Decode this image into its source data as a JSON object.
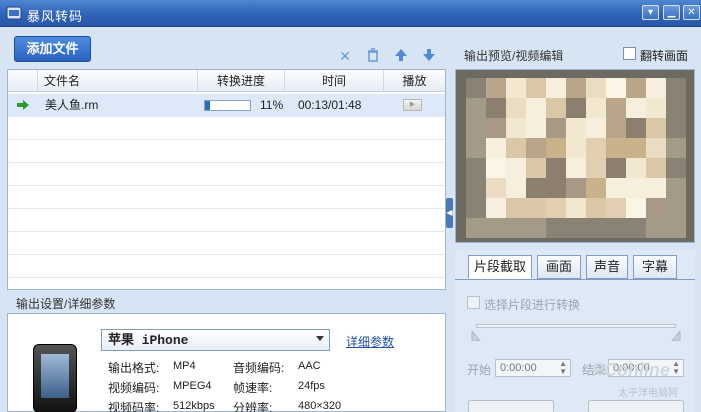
{
  "window": {
    "title": "暴风转码"
  },
  "toolbar": {
    "add_file_label": "添加文件",
    "icons": [
      "close-icon",
      "trash-icon",
      "arrow-up-icon",
      "arrow-down-icon"
    ]
  },
  "file_list": {
    "columns": [
      "文件名",
      "转换进度",
      "时间",
      "播放"
    ],
    "rows": [
      {
        "name": "美人鱼.rm",
        "progress": 0.11,
        "progress_label": "11%",
        "time": "00:13/01:48"
      }
    ]
  },
  "output_settings": {
    "section_title": "输出设置/详细参数",
    "device": {
      "brand": "苹果",
      "model": "iPhone"
    },
    "detail_link": "详细参数",
    "params": [
      {
        "label": "输出格式:",
        "value": "MP4"
      },
      {
        "label": "音频编码:",
        "value": "AAC"
      },
      {
        "label": "视频编码:",
        "value": "MPEG4"
      },
      {
        "label": "帧速率:",
        "value": "24fps"
      },
      {
        "label": "视频码率:",
        "value": "512kbps"
      },
      {
        "label": "分辨率:",
        "value": "480×320"
      }
    ]
  },
  "preview": {
    "section_title": "输出预览/视频编辑",
    "flip_label": "翻转画面"
  },
  "edit_tabs": {
    "tabs": [
      "片段截取",
      "画面",
      "声音",
      "字幕"
    ],
    "active": 0,
    "segment_checkbox_label": "选择片段进行转换",
    "start_label": "开始",
    "start_value": "0:00:00",
    "end_label": "结束",
    "end_value": "0:00:00"
  },
  "watermark": {
    "text": "PConline",
    "subtext": "太平洋电脑网"
  },
  "colors": {
    "accent": "#2f63b8",
    "progress": "#2a6cc8",
    "selected_row": "#dde9f8"
  }
}
